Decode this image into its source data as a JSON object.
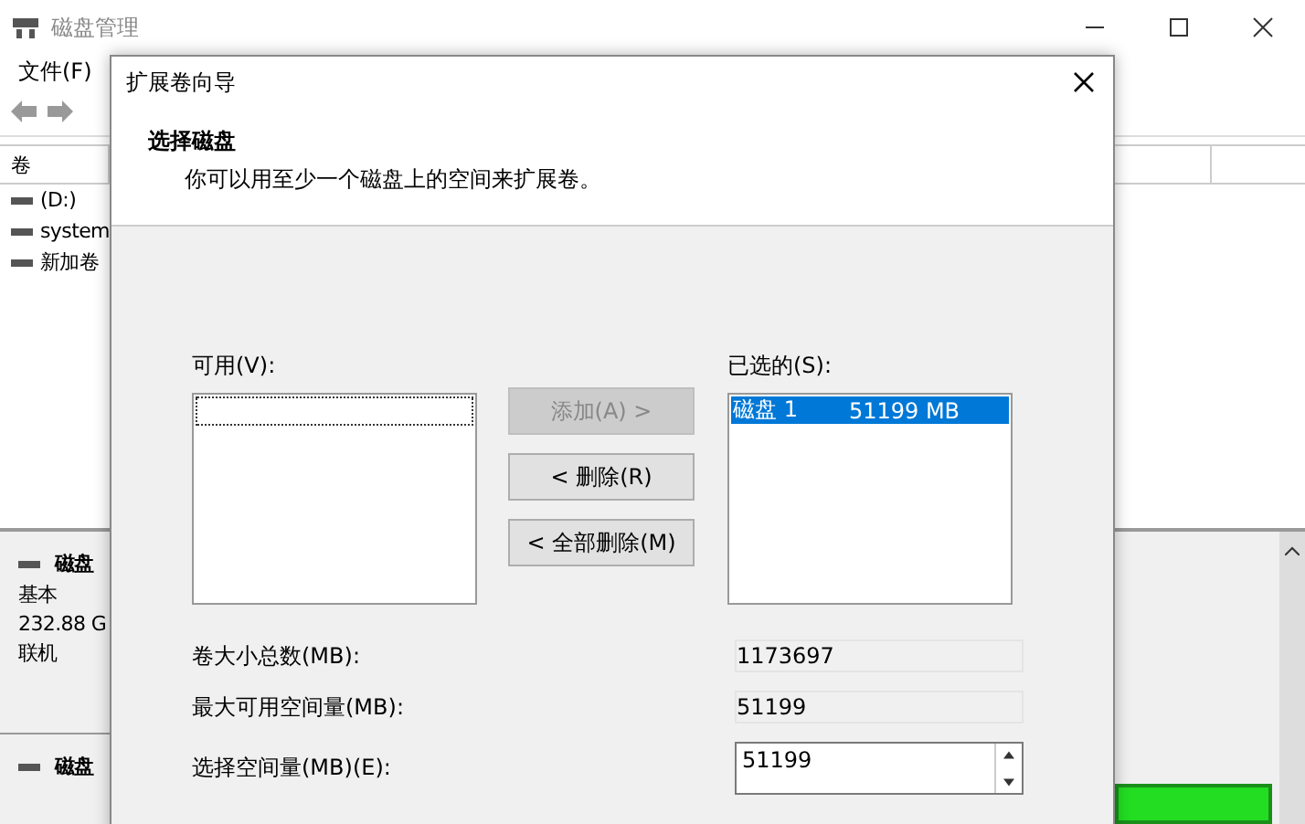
{
  "window": {
    "title": "磁盘管理",
    "menu": [
      "文件(F)"
    ]
  },
  "volume_list": {
    "header": "卷",
    "rows": [
      "(D:)",
      "system",
      "新加卷"
    ]
  },
  "disks": [
    {
      "name": "磁盘",
      "lines": [
        "基本",
        "232.88 G",
        "联机"
      ]
    },
    {
      "name": "磁盘"
    }
  ],
  "dialog": {
    "title": "扩展卷向导",
    "heading": "选择磁盘",
    "subheading": "你可以用至少一个磁盘上的空间来扩展卷。",
    "available": {
      "label": "可用(V):"
    },
    "buttons": [
      {
        "label": "添加(A) >",
        "disabled": true
      },
      {
        "label": "< 删除(R)",
        "disabled": false
      },
      {
        "label": "< 全部删除(M)",
        "disabled": false
      }
    ],
    "selected_list": {
      "label": "已选的(S):",
      "items": [
        {
          "disk": "磁盘 1",
          "size": "51199 MB",
          "selected": true
        }
      ]
    },
    "fields": [
      {
        "kind": "readonly",
        "label": "卷大小总数(MB):",
        "value": "1173697"
      },
      {
        "kind": "readonly",
        "label": "最大可用空间量(MB):",
        "value": "51199"
      },
      {
        "kind": "spin",
        "label": "选择空间量(MB)(E):",
        "value": "51199"
      }
    ]
  }
}
